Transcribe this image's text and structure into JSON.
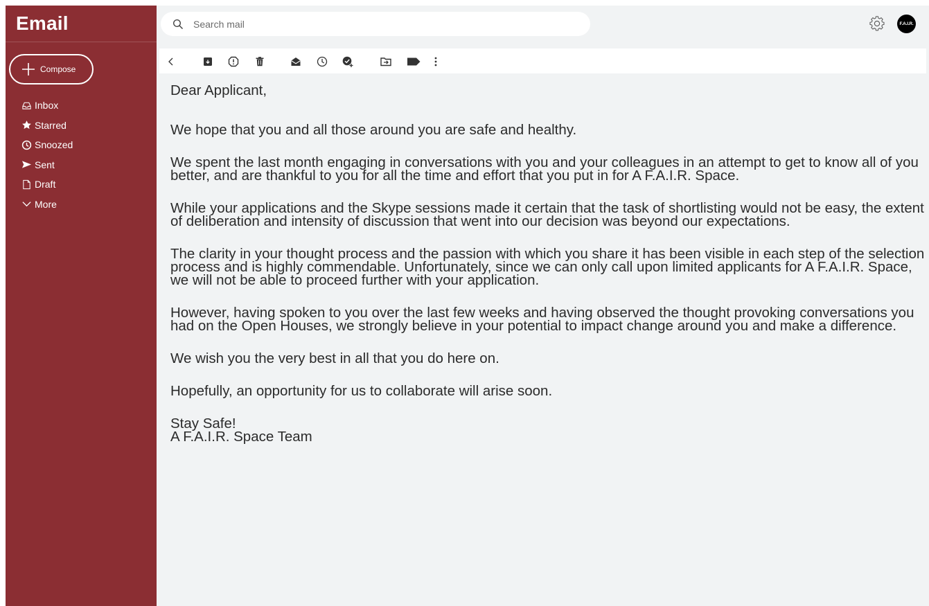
{
  "app": {
    "title": "Email",
    "accent": "#8b2e33"
  },
  "compose": {
    "label": "Compose",
    "icon": "plus-icon"
  },
  "sidebar": {
    "items": [
      {
        "label": "Inbox",
        "icon": "inbox-icon"
      },
      {
        "label": "Starred",
        "icon": "star-icon"
      },
      {
        "label": "Snoozed",
        "icon": "clock-icon"
      },
      {
        "label": "Sent",
        "icon": "send-icon"
      },
      {
        "label": "Draft",
        "icon": "draft-icon"
      },
      {
        "label": "More",
        "icon": "chevron-down-icon"
      }
    ]
  },
  "search": {
    "placeholder": "Search mail",
    "icon": "search-icon"
  },
  "header": {
    "settings_icon": "gear-icon",
    "avatar_text": "F.A.I.R."
  },
  "toolbar": {
    "icons": [
      "back-icon",
      "archive-icon",
      "report-spam-icon",
      "delete-icon",
      "mark-unread-icon",
      "snooze-icon",
      "add-task-icon",
      "move-to-icon",
      "label-icon",
      "more-vertical-icon"
    ]
  },
  "message": {
    "greeting": "Dear Applicant,",
    "paragraphs": [
      "We hope that you and all those around you are safe and healthy.",
      "We spent the last month engaging in conversations with you and your colleagues in an attempt to get to know all of you better, and are thankful to you for all the time and effort that you put in for A F.A.I.R. Space.",
      "While your applications and the Skype sessions made it certain that the task of shortlisting would not be easy, the extent of deliberation and intensity of discussion that went into our decision was beyond our expectations.",
      "The clarity in your thought process and the passion with which you share it has been visible in each step of the selection process and is highly commendable. Unfortunately, since we can only call upon limited applicants for A F.A.I.R. Space, we will not be able to proceed further with your application.",
      "However, having spoken to you over the last few weeks and having observed the thought provoking conversations you had on the Open Houses, we strongly believe in your potential to impact change around you and make a difference.",
      "We wish you the very best in all that you do here on.",
      "Hopefully, an opportunity for us to collaborate will arise soon."
    ],
    "signoff": "Stay Safe!",
    "signature": "A F.A.I.R. Space Team"
  }
}
